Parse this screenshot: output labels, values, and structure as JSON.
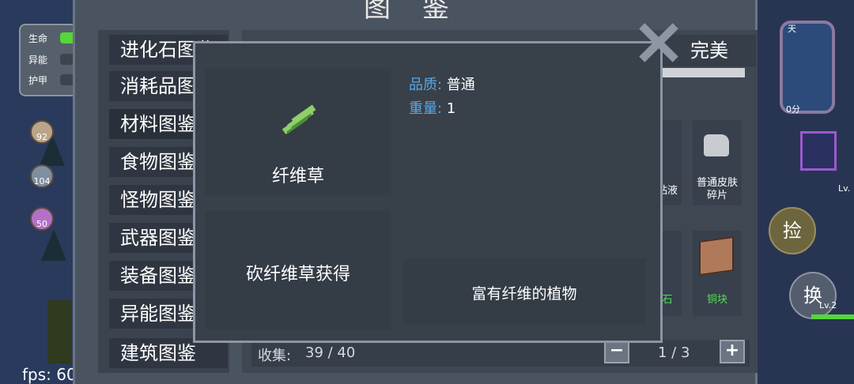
{
  "window": {
    "title": "图鉴"
  },
  "status": {
    "hp_label": "生命",
    "energy_label": "异能",
    "armor_label": "护甲",
    "colors": {
      "hp": "#55d63a",
      "bar_bg": "#3c444e"
    }
  },
  "buffs": [
    "92",
    "104",
    "50"
  ],
  "fps": {
    "text": "fps: 60"
  },
  "categories": [
    {
      "label": "进化石图鉴"
    },
    {
      "label": "消耗品图鉴"
    },
    {
      "label": "材料图鉴"
    },
    {
      "label": "食物图鉴"
    },
    {
      "label": "怪物图鉴"
    },
    {
      "label": "武器图鉴"
    },
    {
      "label": "装备图鉴"
    },
    {
      "label": "异能图鉴"
    },
    {
      "label": "建筑图鉴"
    }
  ],
  "filter": {
    "perfect_label": "完美"
  },
  "grid": {
    "items": [
      {
        "label": "粘液"
      },
      {
        "label": "普通皮肤碎片"
      },
      {
        "label": "石"
      },
      {
        "label": "铜块"
      }
    ]
  },
  "collection": {
    "label": "收集:",
    "value": "39 / 40"
  },
  "pager": {
    "minus": "−",
    "plus": "+",
    "page": "1 / 3"
  },
  "popup": {
    "item_name": "纤维草",
    "source": "砍纤维草获得",
    "quality_label": "品质",
    "quality_value": "普通",
    "weight_label": "重量",
    "weight_value": "1",
    "description": "富有纤维的植物",
    "icon": "fiber-grass-icon",
    "label_color": "#5aa8e6"
  },
  "right_hud": {
    "pick_label": "捡",
    "swap_label": "换",
    "level_label": "Lv.",
    "level2_label": "Lv.2",
    "time_label": "0分",
    "day_label": "天"
  }
}
